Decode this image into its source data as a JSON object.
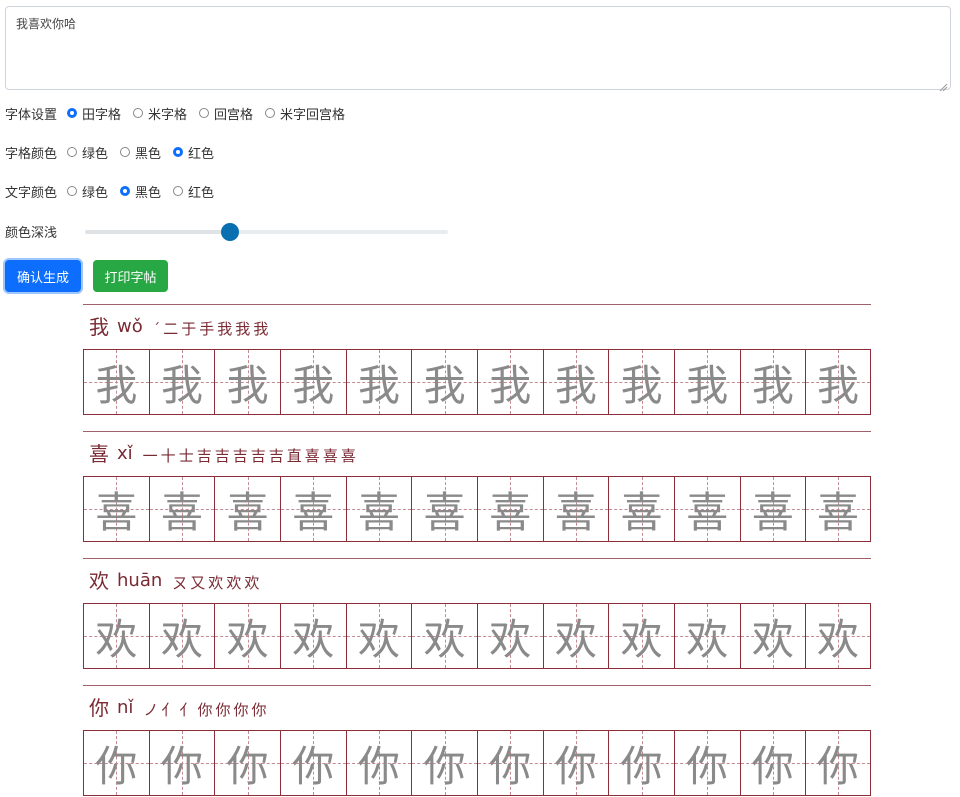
{
  "input": {
    "value": "我喜欢你哈"
  },
  "options": {
    "font": {
      "label": "字体设置",
      "choices": [
        "田字格",
        "米字格",
        "回宫格",
        "米字回宫格"
      ],
      "selected": 0
    },
    "grid_color": {
      "label": "字格颜色",
      "choices": [
        "绿色",
        "黑色",
        "红色"
      ],
      "selected": 2
    },
    "text_color": {
      "label": "文字颜色",
      "choices": [
        "绿色",
        "黑色",
        "红色"
      ],
      "selected": 1
    },
    "shade": {
      "label": "颜色深浅",
      "value_fraction": 0.4
    }
  },
  "buttons": {
    "confirm": "确认生成",
    "print": "打印字帖"
  },
  "colors": {
    "primary": "#0d6efd",
    "success": "#28a745",
    "grid_line": "#8a2e3a",
    "heading_text": "#7a2a33",
    "practice_glyph": "#8a8a8a"
  },
  "characters": [
    {
      "char": "我",
      "pinyin": "wǒ",
      "strokes": [
        "ˊ",
        "二",
        "于",
        "手",
        "我",
        "我",
        "我"
      ]
    },
    {
      "char": "喜",
      "pinyin": "xǐ",
      "strokes": [
        "一",
        "十",
        "士",
        "吉",
        "吉",
        "吉",
        "吉",
        "吉",
        "直",
        "喜",
        "喜",
        "喜"
      ]
    },
    {
      "char": "欢",
      "pinyin": "huān",
      "strokes": [
        "ㄡ",
        "又",
        "欢",
        "欢",
        "欢"
      ]
    },
    {
      "char": "你",
      "pinyin": "nǐ",
      "strokes": [
        "ノ",
        "亻",
        "亻",
        "你",
        "你",
        "你",
        "你"
      ]
    }
  ],
  "cells_per_row": 12
}
